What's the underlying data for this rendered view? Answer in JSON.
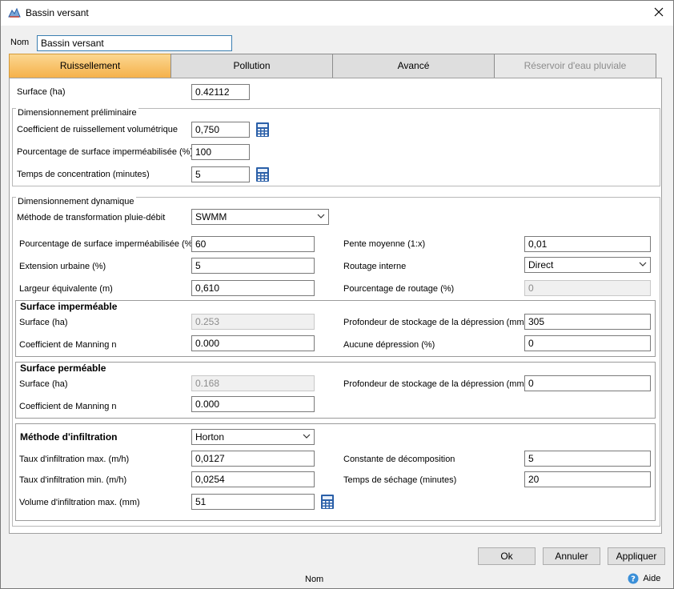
{
  "window": {
    "title": "Bassin versant"
  },
  "name_field": {
    "label": "Nom",
    "value": "Bassin versant"
  },
  "tabs": [
    {
      "label": "Ruissellement",
      "state": "active"
    },
    {
      "label": "Pollution",
      "state": "normal"
    },
    {
      "label": "Avancé",
      "state": "normal"
    },
    {
      "label": "Réservoir d'eau pluviale",
      "state": "disabled"
    }
  ],
  "surface": {
    "label": "Surface (ha)",
    "value": "0.42112"
  },
  "prelim": {
    "title": "Dimensionnement préliminaire",
    "runoff_coef": {
      "label": "Coefficient de ruissellement volumétrique",
      "value": "0,750"
    },
    "imperv_pct": {
      "label": "Pourcentage de surface imperméabilisée (%)",
      "value": "100"
    },
    "conc_time": {
      "label": "Temps de concentration (minutes)",
      "value": "5"
    }
  },
  "dynamic": {
    "title": "Dimensionnement dynamique",
    "method": {
      "label": "Méthode de transformation pluie-débit",
      "value": "SWMM"
    },
    "imperv_pct": {
      "label": "Pourcentage de surface imperméabilisée (%)",
      "value": "60"
    },
    "urban_ext": {
      "label": "Extension urbaine (%)",
      "value": "5"
    },
    "equiv_width": {
      "label": "Largeur équivalente (m)",
      "value": "0,610"
    },
    "slope": {
      "label": "Pente moyenne (1:x)",
      "value": "0,01"
    },
    "internal_routing": {
      "label": "Routage interne",
      "value": "Direct"
    },
    "routing_pct": {
      "label": "Pourcentage de routage (%)",
      "value": "0"
    },
    "impervious": {
      "title": "Surface imperméable",
      "surface": {
        "label": "Surface (ha)",
        "value": "0.253"
      },
      "manning": {
        "label": "Coefficient de Manning n",
        "value": "0.000"
      },
      "depression_storage": {
        "label": "Profondeur de stockage de la dépression (mm)",
        "value": "305"
      },
      "no_depression": {
        "label": "Aucune dépression (%)",
        "value": "0"
      }
    },
    "pervious": {
      "title": "Surface perméable",
      "surface": {
        "label": "Surface (ha)",
        "value": "0.168"
      },
      "manning": {
        "label": "Coefficient de Manning n",
        "value": "0.000"
      },
      "depression_storage": {
        "label": "Profondeur de stockage de la dépression (mm)",
        "value": "0"
      }
    },
    "infiltration": {
      "title": "Méthode d'infiltration",
      "method": {
        "value": "Horton"
      },
      "max_rate": {
        "label": "Taux d'infiltration max. (m/h)",
        "value": "0,0127"
      },
      "min_rate": {
        "label": "Taux d'infiltration min. (m/h)",
        "value": "0,0254"
      },
      "max_volume": {
        "label": "Volume d'infiltration max. (mm)",
        "value": "51"
      },
      "decay": {
        "label": "Constante de décomposition",
        "value": "5"
      },
      "drying_time": {
        "label": "Temps de séchage (minutes)",
        "value": "20"
      }
    }
  },
  "buttons": {
    "ok": "Ok",
    "cancel": "Annuler",
    "apply": "Appliquer"
  },
  "status_bar": {
    "field": "Nom",
    "help": "Aide"
  },
  "colors": {
    "active_tab": "#f5b14a",
    "calc_icon": "#2a5fa8",
    "help_icon": "#3a8fd8"
  }
}
